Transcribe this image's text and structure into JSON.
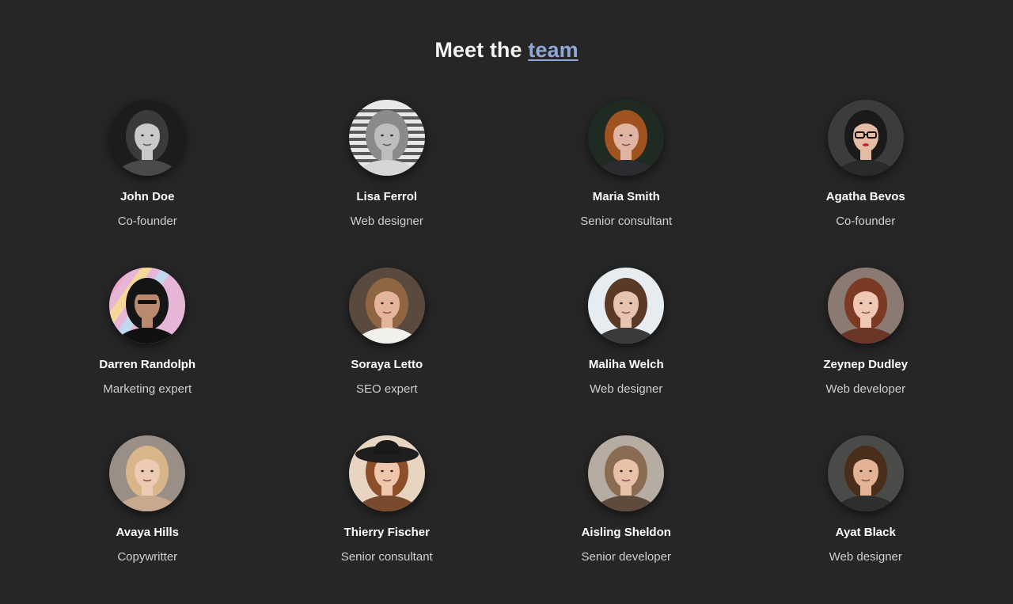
{
  "header": {
    "title_prefix": "Meet the",
    "title_link": "team"
  },
  "team": [
    {
      "name": "John Doe",
      "role": "Co-founder",
      "photo": {
        "bg": "#1c1c1c",
        "skin": "#c9c9c9",
        "hair": "#3a3a3a",
        "top": "#4a4a4a",
        "gray": true
      }
    },
    {
      "name": "Lisa Ferrol",
      "role": "Web designer",
      "photo": {
        "bg": "#e8e8e8",
        "skin": "#bdbdbd",
        "hair": "#8a8a8a",
        "top": "#d6d6d6",
        "gray": true,
        "stripes": true
      }
    },
    {
      "name": "Maria Smith",
      "role": "Senior consultant",
      "photo": {
        "bg": "#1e2a22",
        "skin": "#e0b4a2",
        "hair": "#a0521f",
        "top": "#2c2c30"
      }
    },
    {
      "name": "Agatha Bevos",
      "role": "Co-founder",
      "photo": {
        "bg": "#3c3c3e",
        "skin": "#e6bba4",
        "hair": "#1a1a1a",
        "top": "#2a2a2a",
        "glasses": true
      }
    },
    {
      "name": "Darren Randolph",
      "role": "Marketing expert",
      "photo": {
        "bg": "#e7b6d6",
        "skin": "#b98a6d",
        "hair": "#151515",
        "top": "#111111",
        "cap": true,
        "rainbow": true
      }
    },
    {
      "name": "Soraya Letto",
      "role": "SEO expert",
      "photo": {
        "bg": "#5a4a3e",
        "skin": "#e4b59a",
        "hair": "#8f6542",
        "top": "#f2f0ec"
      }
    },
    {
      "name": "Maliha Welch",
      "role": "Web designer",
      "photo": {
        "bg": "#e6ecf0",
        "skin": "#e8c3b0",
        "hair": "#5a3a26",
        "top": "#3a3a3a"
      }
    },
    {
      "name": "Zeynep Dudley",
      "role": "Web developer",
      "photo": {
        "bg": "#8a7a72",
        "skin": "#efc7b3",
        "hair": "#7a3a24",
        "top": "#6a3628"
      }
    },
    {
      "name": "Avaya Hills",
      "role": "Copywritter",
      "photo": {
        "bg": "#9a8f86",
        "skin": "#eccab3",
        "hair": "#d8b68a",
        "top": "#c8a98e"
      }
    },
    {
      "name": "Thierry Fischer",
      "role": "Senior consultant",
      "photo": {
        "bg": "#e7d5c2",
        "skin": "#f0c7ad",
        "hair": "#8d4e2a",
        "top": "#7a4a2f",
        "hat": true
      }
    },
    {
      "name": "Aisling Sheldon",
      "role": "Senior developer",
      "photo": {
        "bg": "#b7aca2",
        "skin": "#e7c1a8",
        "hair": "#8a6c52",
        "top": "#5e4b3e"
      }
    },
    {
      "name": "Ayat Black",
      "role": "Web designer",
      "photo": {
        "bg": "#4a4a48",
        "skin": "#e4b396",
        "hair": "#4a2e1c",
        "top": "#2e2e2e"
      }
    }
  ]
}
